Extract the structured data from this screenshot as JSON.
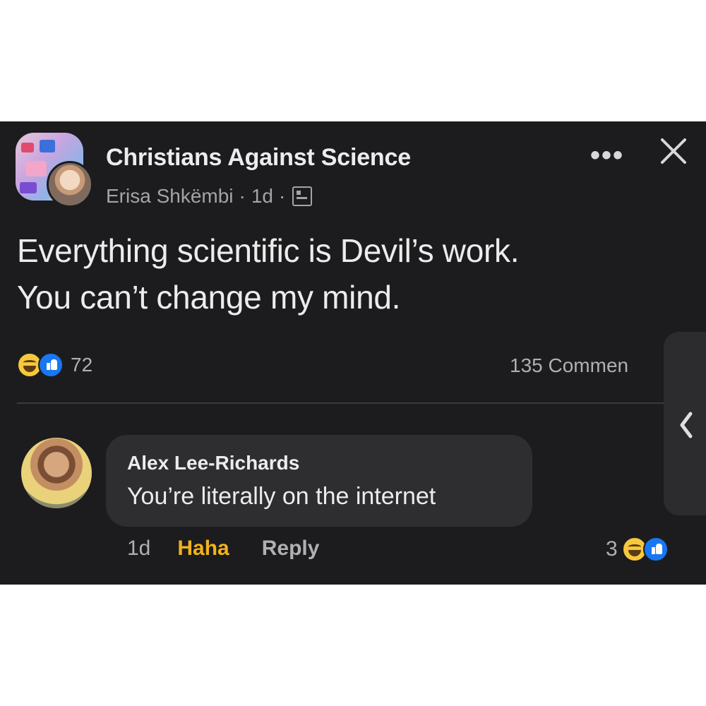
{
  "post": {
    "group_name": "Christians Against Science",
    "author": "Erisa Shkëmbi",
    "separator": "·",
    "time": "1d",
    "text_line1": "Everything scientific is Devil’s work.",
    "text_line2": "You can’t change my mind.",
    "reaction_count": "72",
    "comments_label": "135 Commen",
    "reactions": [
      "haha-icon",
      "like-icon"
    ]
  },
  "header_actions": {
    "more_label": "•••",
    "close_icon": "close-icon"
  },
  "comment": {
    "author": "Alex Lee-Richards",
    "text": "You’re literally on the internet",
    "time": "1d",
    "haha_label": "Haha",
    "reply_label": "Reply",
    "reaction_count": "3",
    "reactions": [
      "haha-icon",
      "like-icon"
    ]
  },
  "colors": {
    "background": "#1c1c1e",
    "bubble": "#2e2e31",
    "haha_accent": "#f2b21b",
    "like_blue": "#1877f2"
  }
}
